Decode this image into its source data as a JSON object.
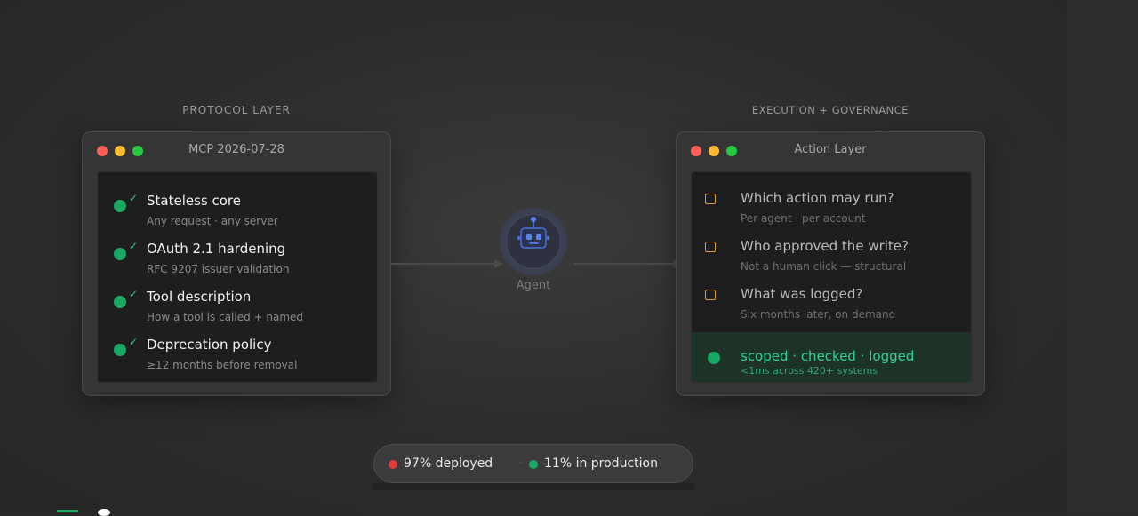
{
  "sections": {
    "left_label": "PROTOCOL LAYER",
    "right_label": "EXECUTION + GOVERNANCE"
  },
  "protocol_window": {
    "title": "MCP 2026-07-28",
    "items": [
      {
        "title": "Stateless core",
        "subtitle": "Any request · any server"
      },
      {
        "title": "OAuth 2.1 hardening",
        "subtitle": "RFC 9207 issuer validation"
      },
      {
        "title": "Tool description",
        "subtitle": "How a tool is called + named"
      },
      {
        "title": "Deprecation policy",
        "subtitle": "≥12 months before removal"
      }
    ],
    "check_glyph": "✓"
  },
  "agent": {
    "label": "Agent",
    "icon": "robot-icon"
  },
  "action_window": {
    "title": "Action Layer",
    "questions": [
      {
        "title": "Which action may run?",
        "subtitle": "Per agent · per account"
      },
      {
        "title": "Who approved the write?",
        "subtitle": "Not a human click — structural"
      },
      {
        "title": "What was logged?",
        "subtitle": "Six months later, on demand"
      }
    ],
    "result": {
      "title": "scoped · checked · logged",
      "subtitle": "<1ms across 420+ systems"
    }
  },
  "status_pill": {
    "deployed": "97% deployed",
    "separator": "·",
    "production": "11% in production"
  },
  "colors": {
    "accent_green": "#1aa865",
    "accent_teal": "#2fd39a",
    "warning_orange": "#e09b3a",
    "alert_red": "#e03b3b"
  }
}
